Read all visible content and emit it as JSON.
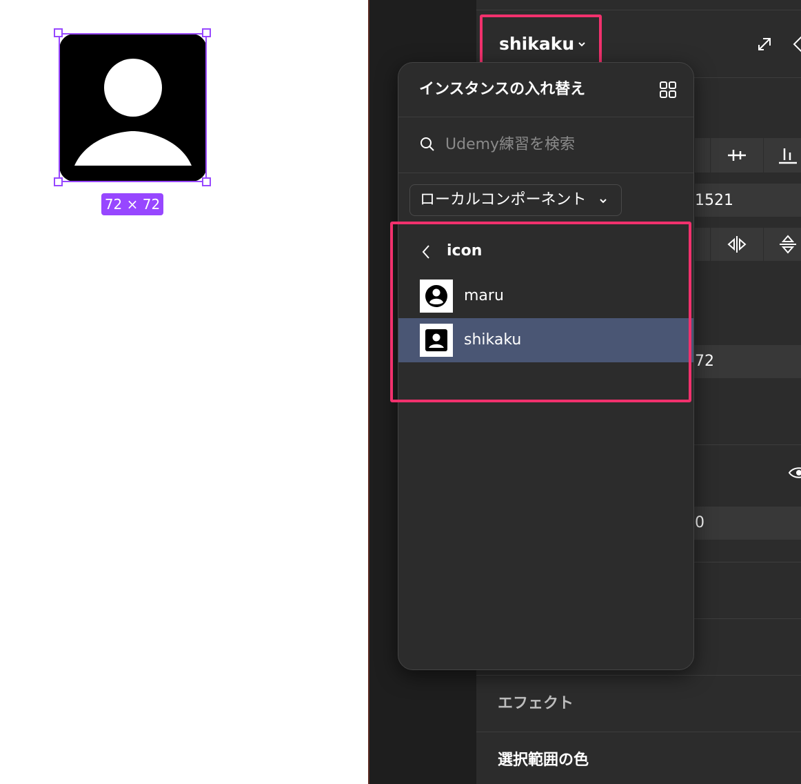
{
  "canvas": {
    "size_badge": "72 × 72",
    "selected_icon": "person-square-icon"
  },
  "properties": {
    "component_name": "shikaku",
    "peek_values": [
      "1521",
      "72",
      "0"
    ],
    "sections": {
      "effects": "エフェクト",
      "selection_colors": "選択範囲の色"
    }
  },
  "swap_popup": {
    "title": "インスタンスの入れ替え",
    "search_placeholder": "Udemy練習を検索",
    "library": "ローカルコンポーネント",
    "folder": "icon",
    "items": [
      {
        "label": "maru",
        "icon": "person-circle-icon",
        "selected": false
      },
      {
        "label": "shikaku",
        "icon": "person-square-icon",
        "selected": true
      }
    ]
  },
  "colors": {
    "accent_purple": "#9747ff",
    "highlight_pink": "#f1316d",
    "selected_row": "#4a5674",
    "panel_bg": "#2c2c2c"
  }
}
